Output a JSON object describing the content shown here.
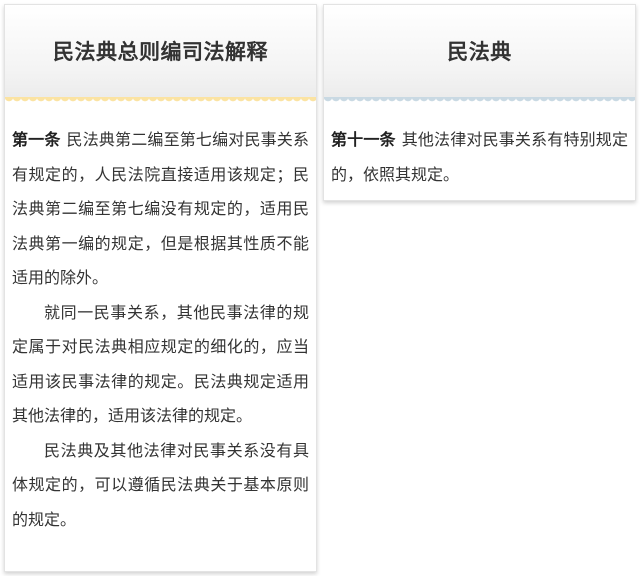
{
  "left_card": {
    "title": "民法典总则编司法解释",
    "article_no": "第一条",
    "paragraphs": [
      "民法典第二编至第七编对民事关系有规定的，人民法院直接适用该规定；民法典第二编至第七编没有规定的，适用民法典第一编的规定，但是根据其性质不能适用的除外。",
      "就同一民事关系，其他民事法律的规定属于对民法典相应规定的细化的，应当适用该民事法律的规定。民法典规定适用其他法律的，适用该法律的规定。",
      "民法典及其他法律对民事关系没有具体规定的，可以遵循民法典关于基本原则的规定。"
    ],
    "scallop_color": "#fbe3a2"
  },
  "right_card": {
    "title": "民法典",
    "article_no": "第十一条",
    "paragraphs": [
      "其他法律对民事关系有特别规定的，依照其规定。"
    ],
    "scallop_color": "#c9d9e3"
  }
}
